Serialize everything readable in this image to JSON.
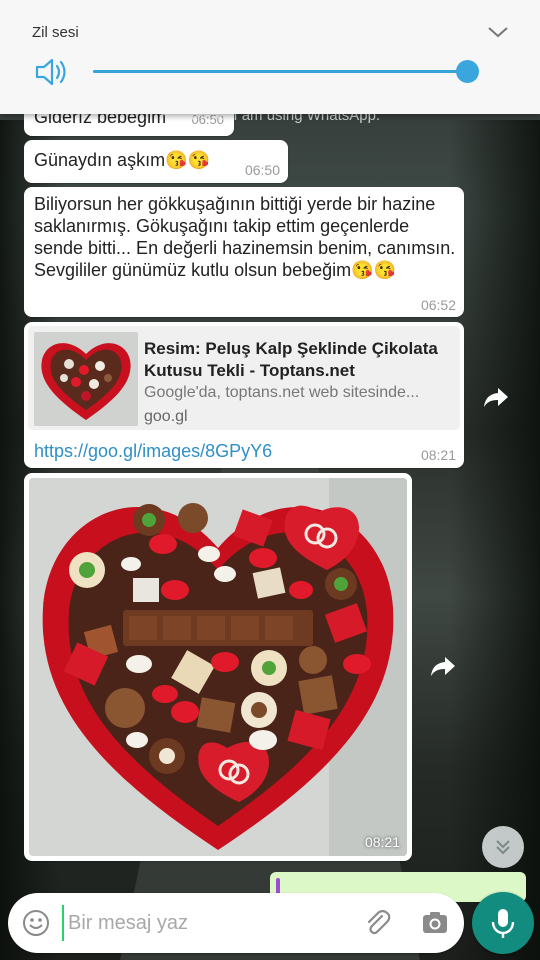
{
  "volume_panel": {
    "title": "Zil sesi",
    "level_percent": 100,
    "accent_color": "#3aa6dd",
    "icons": {
      "speaker": "speaker-icon",
      "expand": "chevron-down-icon"
    }
  },
  "messages": [
    {
      "text": "Giderız bebeğim",
      "time": "06:50",
      "overlay_status": "Hey there! I am using WhatsApp."
    },
    {
      "text": "Günaydın aşkım😘😘",
      "time": "06:50"
    },
    {
      "text": "Biliyorsun her gökkuşağının bittiği yerde bir hazine saklanırmış. Gökuşağını takip ettim geçenlerde sende bitti... En değerli hazinemsin benim, canımsın. Sevgililer günümüz kutlu olsun bebeğim😘😘",
      "time": "06:52"
    },
    {
      "link_preview": {
        "title": "Resim: Peluş Kalp Şeklinde Çikolata Kutusu Tekli - Toptans.net",
        "description": "Google'da, toptans.net web sitesinde...",
        "domain": "goo.gl"
      },
      "url": "https://goo.gl/images/8GPyY6",
      "time": "08:21"
    },
    {
      "image_caption_time": "08:21",
      "image_alt": "Heart-shaped chocolate box"
    }
  ],
  "input": {
    "placeholder": "Bir mesaj yaz",
    "value": ""
  },
  "icons": {
    "emoji": "emoji-icon",
    "attach": "paperclip-icon",
    "camera": "camera-icon",
    "mic": "microphone-icon",
    "forward": "forward-icon",
    "scroll_down": "double-chevron-down-icon"
  },
  "colors": {
    "link": "#2f8fc7",
    "mic_button": "#128c7e",
    "outgoing_bubble": "#dcf8c6"
  }
}
